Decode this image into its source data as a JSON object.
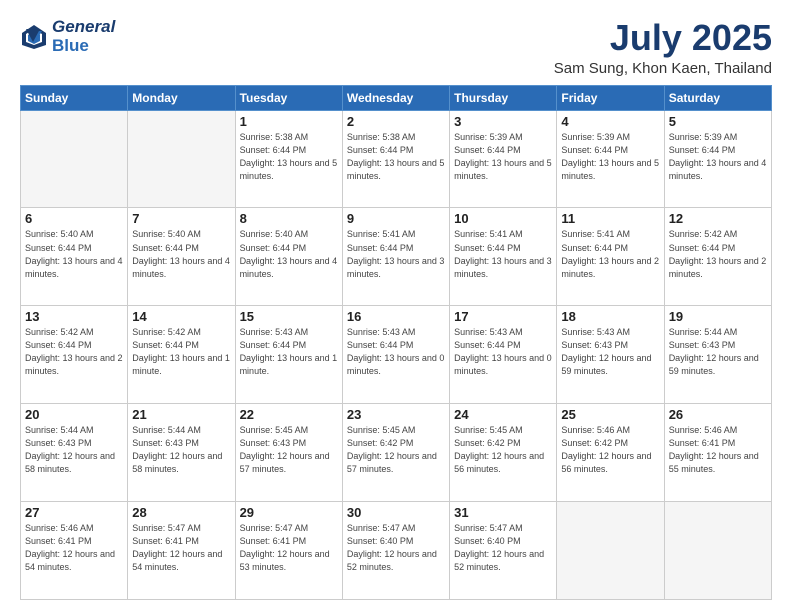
{
  "header": {
    "logo_line1": "General",
    "logo_line2": "Blue",
    "title": "July 2025",
    "subtitle": "Sam Sung, Khon Kaen, Thailand"
  },
  "weekdays": [
    "Sunday",
    "Monday",
    "Tuesday",
    "Wednesday",
    "Thursday",
    "Friday",
    "Saturday"
  ],
  "weeks": [
    [
      {
        "day": "",
        "info": ""
      },
      {
        "day": "",
        "info": ""
      },
      {
        "day": "1",
        "info": "Sunrise: 5:38 AM\nSunset: 6:44 PM\nDaylight: 13 hours and 5 minutes."
      },
      {
        "day": "2",
        "info": "Sunrise: 5:38 AM\nSunset: 6:44 PM\nDaylight: 13 hours and 5 minutes."
      },
      {
        "day": "3",
        "info": "Sunrise: 5:39 AM\nSunset: 6:44 PM\nDaylight: 13 hours and 5 minutes."
      },
      {
        "day": "4",
        "info": "Sunrise: 5:39 AM\nSunset: 6:44 PM\nDaylight: 13 hours and 5 minutes."
      },
      {
        "day": "5",
        "info": "Sunrise: 5:39 AM\nSunset: 6:44 PM\nDaylight: 13 hours and 4 minutes."
      }
    ],
    [
      {
        "day": "6",
        "info": "Sunrise: 5:40 AM\nSunset: 6:44 PM\nDaylight: 13 hours and 4 minutes."
      },
      {
        "day": "7",
        "info": "Sunrise: 5:40 AM\nSunset: 6:44 PM\nDaylight: 13 hours and 4 minutes."
      },
      {
        "day": "8",
        "info": "Sunrise: 5:40 AM\nSunset: 6:44 PM\nDaylight: 13 hours and 4 minutes."
      },
      {
        "day": "9",
        "info": "Sunrise: 5:41 AM\nSunset: 6:44 PM\nDaylight: 13 hours and 3 minutes."
      },
      {
        "day": "10",
        "info": "Sunrise: 5:41 AM\nSunset: 6:44 PM\nDaylight: 13 hours and 3 minutes."
      },
      {
        "day": "11",
        "info": "Sunrise: 5:41 AM\nSunset: 6:44 PM\nDaylight: 13 hours and 2 minutes."
      },
      {
        "day": "12",
        "info": "Sunrise: 5:42 AM\nSunset: 6:44 PM\nDaylight: 13 hours and 2 minutes."
      }
    ],
    [
      {
        "day": "13",
        "info": "Sunrise: 5:42 AM\nSunset: 6:44 PM\nDaylight: 13 hours and 2 minutes."
      },
      {
        "day": "14",
        "info": "Sunrise: 5:42 AM\nSunset: 6:44 PM\nDaylight: 13 hours and 1 minute."
      },
      {
        "day": "15",
        "info": "Sunrise: 5:43 AM\nSunset: 6:44 PM\nDaylight: 13 hours and 1 minute."
      },
      {
        "day": "16",
        "info": "Sunrise: 5:43 AM\nSunset: 6:44 PM\nDaylight: 13 hours and 0 minutes."
      },
      {
        "day": "17",
        "info": "Sunrise: 5:43 AM\nSunset: 6:44 PM\nDaylight: 13 hours and 0 minutes."
      },
      {
        "day": "18",
        "info": "Sunrise: 5:43 AM\nSunset: 6:43 PM\nDaylight: 12 hours and 59 minutes."
      },
      {
        "day": "19",
        "info": "Sunrise: 5:44 AM\nSunset: 6:43 PM\nDaylight: 12 hours and 59 minutes."
      }
    ],
    [
      {
        "day": "20",
        "info": "Sunrise: 5:44 AM\nSunset: 6:43 PM\nDaylight: 12 hours and 58 minutes."
      },
      {
        "day": "21",
        "info": "Sunrise: 5:44 AM\nSunset: 6:43 PM\nDaylight: 12 hours and 58 minutes."
      },
      {
        "day": "22",
        "info": "Sunrise: 5:45 AM\nSunset: 6:43 PM\nDaylight: 12 hours and 57 minutes."
      },
      {
        "day": "23",
        "info": "Sunrise: 5:45 AM\nSunset: 6:42 PM\nDaylight: 12 hours and 57 minutes."
      },
      {
        "day": "24",
        "info": "Sunrise: 5:45 AM\nSunset: 6:42 PM\nDaylight: 12 hours and 56 minutes."
      },
      {
        "day": "25",
        "info": "Sunrise: 5:46 AM\nSunset: 6:42 PM\nDaylight: 12 hours and 56 minutes."
      },
      {
        "day": "26",
        "info": "Sunrise: 5:46 AM\nSunset: 6:41 PM\nDaylight: 12 hours and 55 minutes."
      }
    ],
    [
      {
        "day": "27",
        "info": "Sunrise: 5:46 AM\nSunset: 6:41 PM\nDaylight: 12 hours and 54 minutes."
      },
      {
        "day": "28",
        "info": "Sunrise: 5:47 AM\nSunset: 6:41 PM\nDaylight: 12 hours and 54 minutes."
      },
      {
        "day": "29",
        "info": "Sunrise: 5:47 AM\nSunset: 6:41 PM\nDaylight: 12 hours and 53 minutes."
      },
      {
        "day": "30",
        "info": "Sunrise: 5:47 AM\nSunset: 6:40 PM\nDaylight: 12 hours and 52 minutes."
      },
      {
        "day": "31",
        "info": "Sunrise: 5:47 AM\nSunset: 6:40 PM\nDaylight: 12 hours and 52 minutes."
      },
      {
        "day": "",
        "info": ""
      },
      {
        "day": "",
        "info": ""
      }
    ]
  ]
}
